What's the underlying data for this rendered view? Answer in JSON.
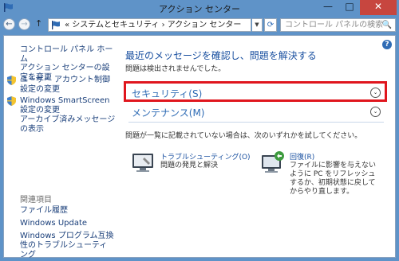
{
  "window": {
    "title": "アクション センター",
    "min": "—",
    "max": "□",
    "close": "✕"
  },
  "nav": {
    "back": "←",
    "forward": "→",
    "up": "↑",
    "address_chevron": "«",
    "address_path": "« システムとセキュリティ › アクション センター",
    "dropdown": "▼",
    "refresh": "⟳",
    "search_placeholder": "コントロール パネルの検索",
    "search_icon": "🔍"
  },
  "sidebar": {
    "home": "コントロール パネル ホーム",
    "items": [
      "アクション センターの設定を変更",
      "ユーザー アカウント制御設定の変更",
      "Windows SmartScreen 設定の変更",
      "アーカイブ済みメッセージの表示"
    ],
    "related_title": "関連項目",
    "related": [
      "ファイル履歴",
      "Windows Update",
      "Windows プログラム互換性のトラブルシューティング"
    ]
  },
  "main": {
    "help": "?",
    "heading": "最近のメッセージを確認し、問題を解決する",
    "subtext": "問題は検出されませんでした。",
    "sections": [
      {
        "label": "セキュリティ(S)",
        "chevron": "⌄"
      },
      {
        "label": "メンテナンス(M)",
        "chevron": "⌄"
      }
    ],
    "prompt": "問題が一覧に記載されていない場合は、次のいずれかを試してください。",
    "tools": [
      {
        "title": "トラブルシューティング(O)",
        "desc": "問題の発見と解決"
      },
      {
        "title": "回復(R)",
        "desc": "ファイルに影響を与えないように PC をリフレッシュするか、初期状態に戻してからやり直します。"
      }
    ]
  },
  "colors": {
    "accent": "#2f6cb5",
    "highlight": "#e0161e",
    "frame": "#5f93c8"
  }
}
